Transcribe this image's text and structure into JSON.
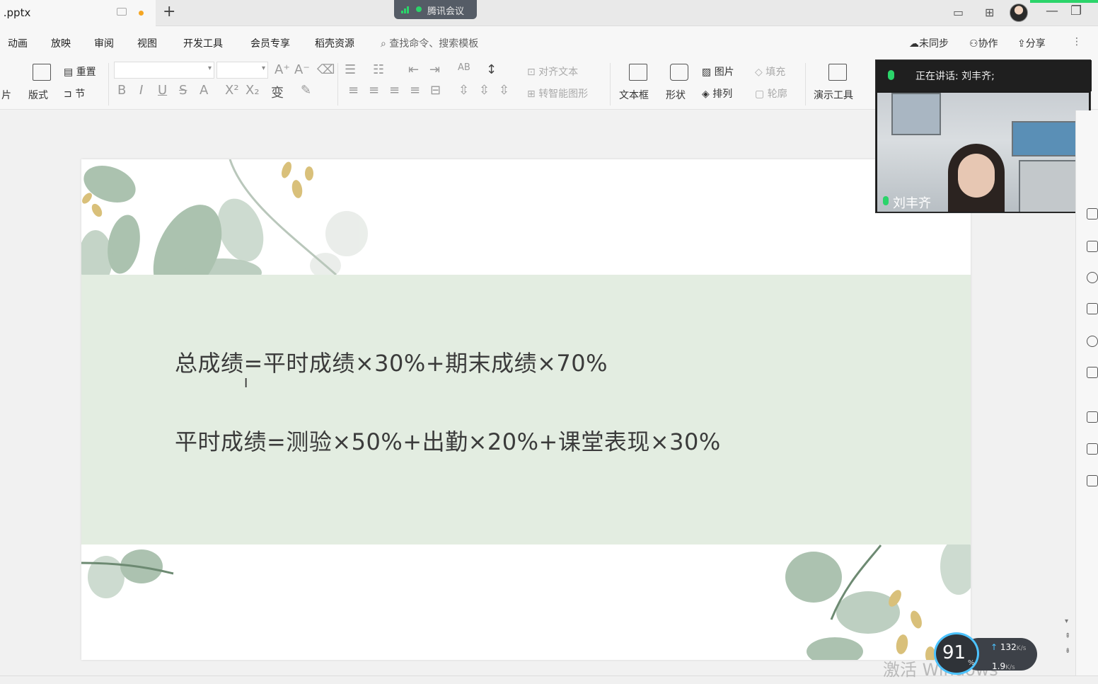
{
  "titlebar": {
    "file_name": " .pptx",
    "new_tab": "+",
    "meeting_label": "腾讯会议",
    "window": {
      "minimize": "—",
      "restore": "❐"
    }
  },
  "menu": {
    "items": [
      "动画",
      "放映",
      "审阅",
      "视图",
      "开发工具",
      "会员专享",
      "稻壳资源"
    ],
    "search": "查找命令、搜索模板",
    "sync": "未同步",
    "collab": "协作",
    "share": "分享"
  },
  "toolbar": {
    "reset": "重置",
    "slide_cut": "片",
    "layout": "版式",
    "section": "节",
    "align_text": "对齐文本",
    "smart_shape": "转智能图形",
    "text_box": "文本框",
    "shape": "形状",
    "picture": "图片",
    "arrange": "排列",
    "fill": "填充",
    "outline": "轮廓",
    "present_tools": "演示工具"
  },
  "slide": {
    "line1": "总成绩=平时成绩×30%+期末成绩×70%",
    "line2": "平时成绩=测验×50%+出勤×20%+课堂表现×30%"
  },
  "video": {
    "speaking": "正在讲话: 刘丰齐;",
    "name": "刘丰齐"
  },
  "network": {
    "percent": "91",
    "percent_sign": "%",
    "up": "132",
    "up_unit": "K/s",
    "down": "1.9",
    "down_unit": "K/s"
  },
  "watermark": "激活 Windows",
  "colors": {
    "band": "#e3ede1",
    "accent_green": "#2bd46a",
    "leaf": "#9db8a2",
    "bud": "#d9c07a"
  }
}
